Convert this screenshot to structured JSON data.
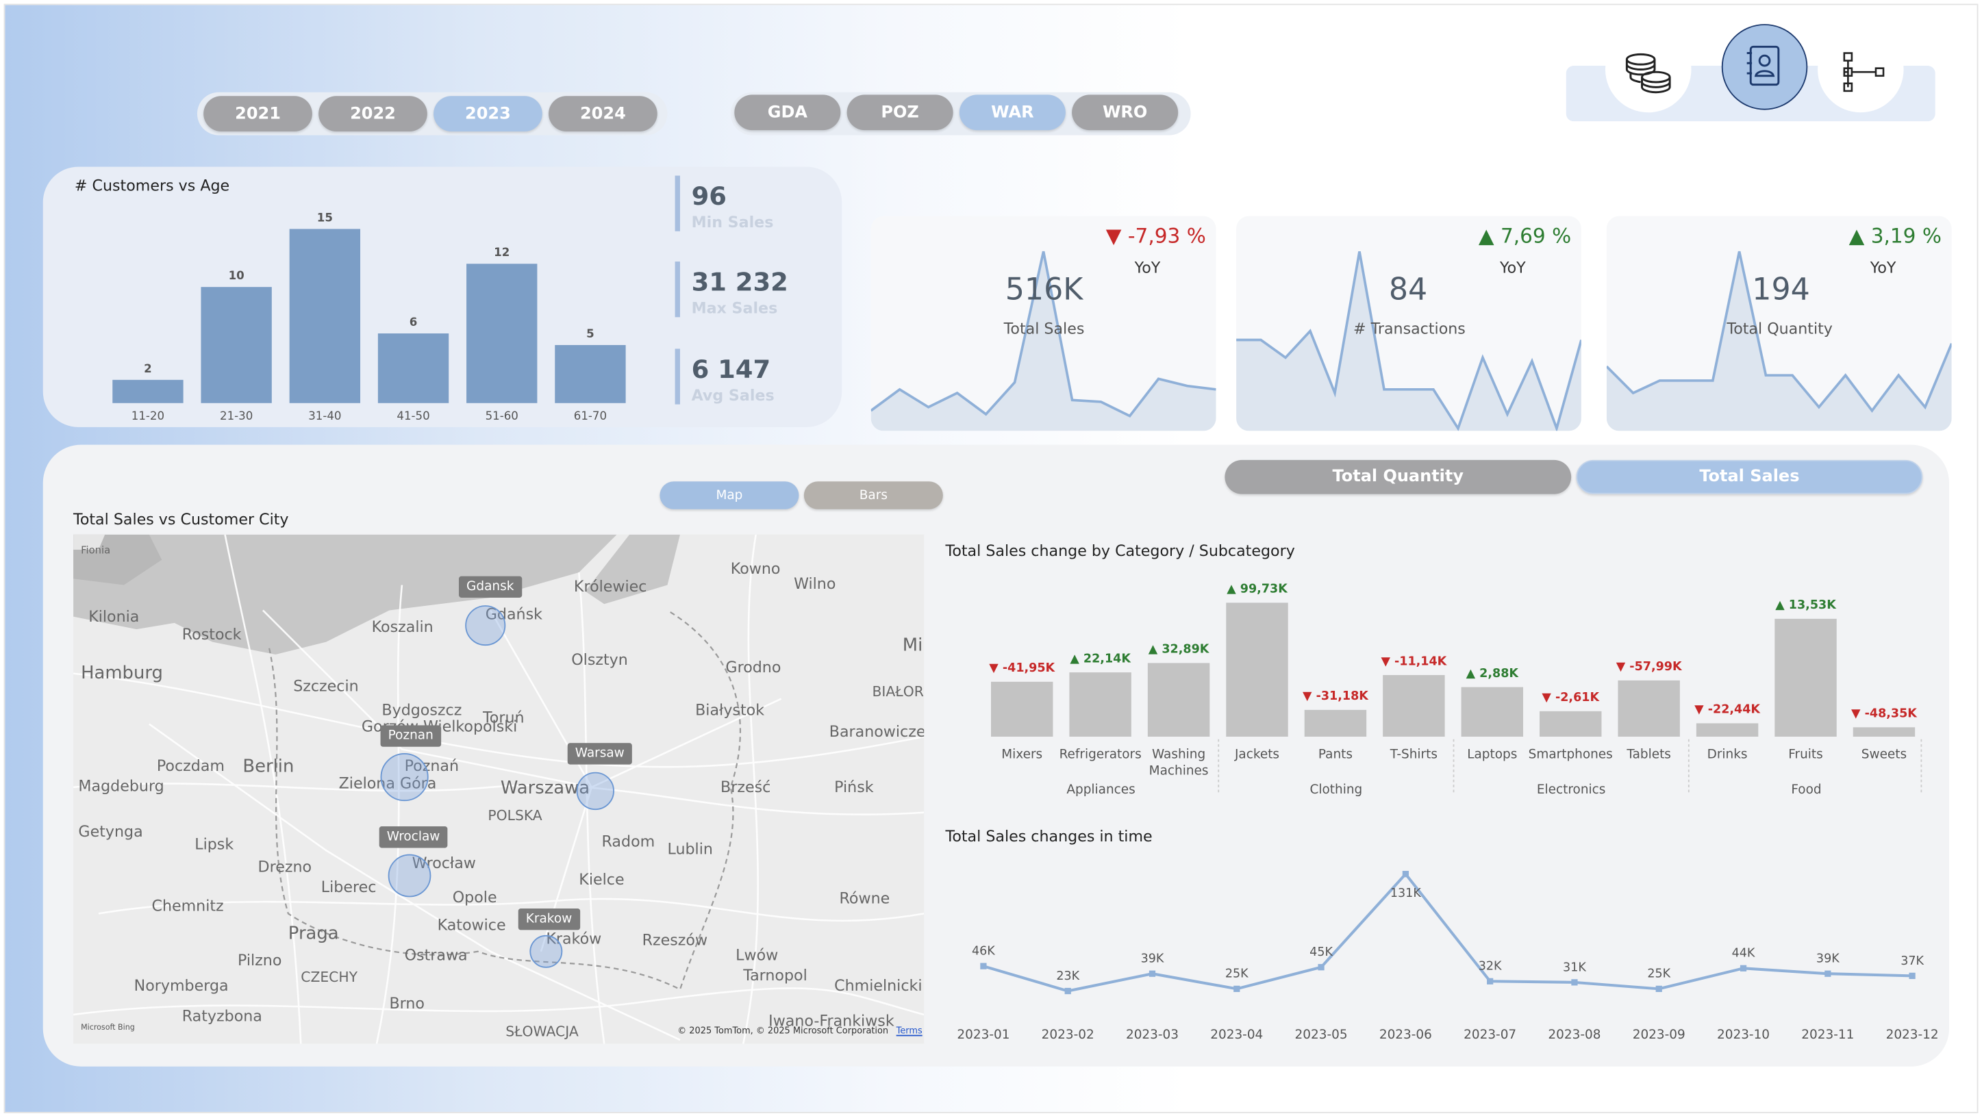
{
  "filters": {
    "years": [
      "2021",
      "2022",
      "2023",
      "2024"
    ],
    "selected_year": "2023",
    "cities": [
      "GDA",
      "POZ",
      "WAR",
      "WRO"
    ],
    "selected_city": "WAR"
  },
  "nav": {
    "icons": [
      "coins-icon",
      "contact-book-icon",
      "hierarchy-icon"
    ],
    "active": "contact-book-icon"
  },
  "customers_age": {
    "title": "# Customers vs Age",
    "categories": [
      "11-20",
      "21-30",
      "31-40",
      "41-50",
      "51-60",
      "61-70"
    ],
    "values": [
      2,
      10,
      15,
      6,
      12,
      5
    ]
  },
  "stats": [
    {
      "value": "96",
      "label": "Min Sales"
    },
    {
      "value": "31 232",
      "label": "Max Sales"
    },
    {
      "value": "6 147",
      "label": "Avg Sales"
    }
  ],
  "kpis": [
    {
      "change": "-7,93 %",
      "dir": "down",
      "yoy": "YoY",
      "value": "516K",
      "label": "Total Sales",
      "spark": [
        10,
        22,
        12,
        20,
        8,
        26,
        100,
        16,
        15,
        7,
        28,
        24,
        22
      ]
    },
    {
      "change": "7,69 %",
      "dir": "up",
      "yoy": "YoY",
      "value": "84",
      "label": "# Transactions",
      "spark": [
        50,
        50,
        40,
        55,
        20,
        100,
        22,
        22,
        22,
        0,
        40,
        8,
        38,
        0,
        50
      ]
    },
    {
      "change": "3,19 %",
      "dir": "up",
      "yoy": "YoY",
      "value": "194",
      "label": "Total Quantity",
      "spark": [
        35,
        20,
        27,
        27,
        27,
        100,
        30,
        30,
        12,
        30,
        10,
        30,
        12,
        48
      ]
    }
  ],
  "view_toggle": {
    "map": "Map",
    "bars": "Bars"
  },
  "measure_toggle": {
    "qty": "Total Quantity",
    "sales": "Total Sales"
  },
  "map": {
    "title": "Total Sales vs Customer City",
    "labels": [
      "Fionia",
      "Kilonia",
      "Rostock",
      "Hamburg",
      "Koszalin",
      "Gdańsk",
      "Królewiec",
      "Kowno",
      "Wilno",
      "Olsztyn",
      "Grodno",
      "Szczecin",
      "Bydgoszcz",
      "Toruń",
      "Białystok",
      "Gorzów Wielkopolski",
      "Poznań",
      "Berlin",
      "Poczdam",
      "Magdeburg",
      "Zielona Góra",
      "Warszawa",
      "POLSKA",
      "Brześć",
      "Pińsk",
      "Baranowicze",
      "BIAŁOR",
      "Mi",
      "Getynga",
      "Lipsk",
      "Drezno",
      "Wrocław",
      "Radom",
      "Lublin",
      "Kielce",
      "Liberec",
      "Opole",
      "Chemnitz",
      "Praga",
      "Katowice",
      "Ostrawa",
      "Kraków",
      "Rzeszów",
      "Lwów",
      "Tarnopol",
      "Równe",
      "Chmielnicki",
      "Pilzno",
      "CZECHY",
      "Norymberga",
      "Brno",
      "Ratyzbona",
      "SŁOWACJA",
      "Iwano-Frankiwsk"
    ],
    "tags": [
      "Gdansk",
      "Poznan",
      "Warsaw",
      "Wroclaw",
      "Krakow"
    ],
    "copyright": "© 2025 TomTom, © 2025 Microsoft Corporation",
    "terms": "Terms",
    "bing": "Microsoft Bing"
  },
  "category_chart": {
    "title": "Total Sales change by Category / Subcategory",
    "subcategories": [
      "Mixers",
      "Refrigerators",
      "Washing Machines",
      "Jackets",
      "Pants",
      "T-Shirts",
      "Laptops",
      "Smartphones",
      "Tablets",
      "Drinks",
      "Fruits",
      "Sweets"
    ],
    "categories": [
      "Appliances",
      "Clothing",
      "Electronics",
      "Food"
    ],
    "labels": [
      "-41,95K",
      "22,14K",
      "32,89K",
      "99,73K",
      "-31,18K",
      "-11,14K",
      "2,88K",
      "-2,61K",
      "-57,99K",
      "-22,44K",
      "13,53K",
      "-48,35K"
    ],
    "values": [
      -41.95,
      22.14,
      32.89,
      99.73,
      -31.18,
      -11.14,
      2.88,
      -2.61,
      -57.99,
      -22.44,
      13.53,
      -48.35
    ],
    "bar_totals": [
      41,
      48,
      55,
      100,
      20,
      46,
      37,
      19,
      42,
      10,
      88,
      7
    ]
  },
  "time_chart": {
    "title": "Total Sales changes in time",
    "x": [
      "2023-01",
      "2023-02",
      "2023-03",
      "2023-04",
      "2023-05",
      "2023-06",
      "2023-07",
      "2023-08",
      "2023-09",
      "2023-10",
      "2023-11",
      "2023-12"
    ],
    "labels": [
      "46K",
      "23K",
      "39K",
      "25K",
      "45K",
      "131K",
      "32K",
      "31K",
      "25K",
      "44K",
      "39K",
      "37K"
    ],
    "values": [
      46,
      23,
      39,
      25,
      45,
      131,
      32,
      31,
      25,
      44,
      39,
      37
    ]
  }
}
